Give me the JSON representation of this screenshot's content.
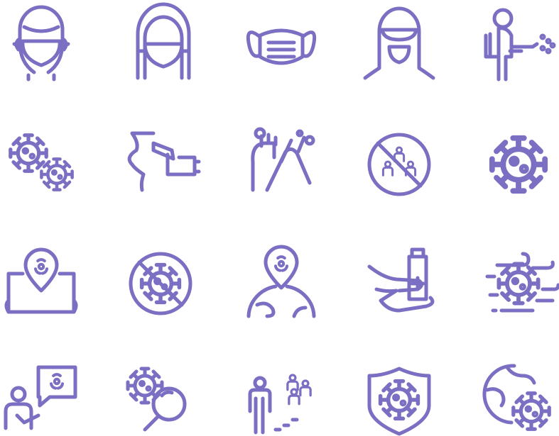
{
  "stroke_color": "#7A6FC2",
  "background": "#FFFFFF",
  "icons": [
    "man-face-mask-icon",
    "woman-face-mask-icon",
    "surgical-mask-icon",
    "hazmat-hood-icon",
    "disinfection-sprayer-icon",
    "virus-cluster-icon",
    "temperature-check-icon",
    "hand-washing-icon",
    "no-crowd-icon",
    "coronavirus-icon",
    "outbreak-map-icon",
    "no-virus-icon",
    "global-outbreak-pin-icon",
    "hand-sanitizer-icon",
    "airborne-virus-icon",
    "consultation-biohazard-icon",
    "virus-search-icon",
    "social-distancing-icon",
    "virus-shield-icon",
    "global-pandemic-icon"
  ]
}
